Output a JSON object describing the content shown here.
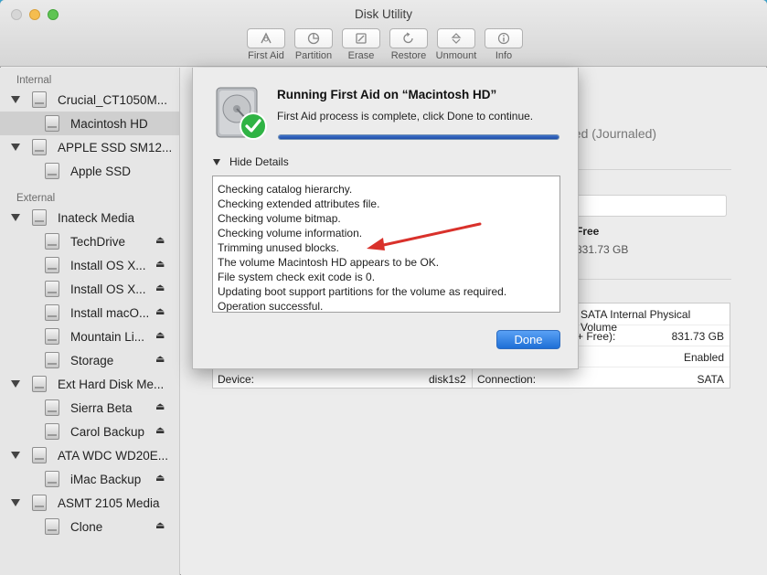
{
  "window": {
    "title": "Disk Utility"
  },
  "toolbar": {
    "items": [
      {
        "label": "First Aid",
        "icon": "first-aid-icon"
      },
      {
        "label": "Partition",
        "icon": "partition-icon"
      },
      {
        "label": "Erase",
        "icon": "erase-icon"
      },
      {
        "label": "Restore",
        "icon": "restore-icon"
      },
      {
        "label": "Unmount",
        "icon": "unmount-icon"
      },
      {
        "label": "Info",
        "icon": "info-icon"
      }
    ]
  },
  "sidebar": {
    "internal_label": "Internal",
    "external_label": "External",
    "internal": [
      {
        "label": "Crucial_CT1050M...",
        "level": 0
      },
      {
        "label": "Macintosh HD",
        "level": 1,
        "selected": true
      },
      {
        "label": "APPLE SSD SM12...",
        "level": 0
      },
      {
        "label": "Apple SSD",
        "level": 1
      }
    ],
    "external": [
      {
        "label": "Inateck Media",
        "level": 0
      },
      {
        "label": "TechDrive",
        "level": 1,
        "eject": true
      },
      {
        "label": "Install OS X...",
        "level": 1,
        "eject": true
      },
      {
        "label": "Install OS X...",
        "level": 1,
        "eject": true
      },
      {
        "label": "Install macO...",
        "level": 1,
        "eject": true
      },
      {
        "label": "Mountain Li...",
        "level": 1,
        "eject": true
      },
      {
        "label": "Storage",
        "level": 1,
        "eject": true
      },
      {
        "label": "Ext Hard Disk Me...",
        "level": 0
      },
      {
        "label": "Sierra Beta",
        "level": 1,
        "eject": true
      },
      {
        "label": "Carol Backup",
        "level": 1,
        "eject": true
      },
      {
        "label": "ATA WDC WD20E...",
        "level": 0
      },
      {
        "label": "iMac Backup",
        "level": 1,
        "eject": true
      },
      {
        "label": "ASMT 2105 Media",
        "level": 0
      },
      {
        "label": "Clone",
        "level": 1,
        "eject": true
      }
    ]
  },
  "main_bg": {
    "format_partial": "ded (Journaled)",
    "free_label": "Free",
    "free_value": "831.73 GB",
    "info": {
      "row1_right": "SATA Internal Physical Volume",
      "row2_right_label": "+ Free):",
      "row2_right_value": "831.73 GB",
      "row3_right_value": "Enabled",
      "device_label": "Device:",
      "device_value": "disk1s2",
      "connection_label": "Connection:",
      "connection_value": "SATA"
    }
  },
  "sheet": {
    "title": "Running First Aid on “Macintosh HD”",
    "message": "First Aid process is complete, click Done to continue.",
    "progress": 1.0,
    "details_toggle": "Hide Details",
    "log": [
      "Checking catalog hierarchy.",
      "Checking extended attributes file.",
      "Checking volume bitmap.",
      "Checking volume information.",
      "Trimming unused blocks.",
      "The volume Macintosh HD appears to be OK.",
      "File system check exit code is 0.",
      "Updating boot support partitions for the volume as required.",
      "Operation successful."
    ],
    "done_label": "Done"
  },
  "colors": {
    "accent": "#1e6fd6",
    "annotation_arrow": "#d9312b",
    "success_check": "#2fb344"
  }
}
